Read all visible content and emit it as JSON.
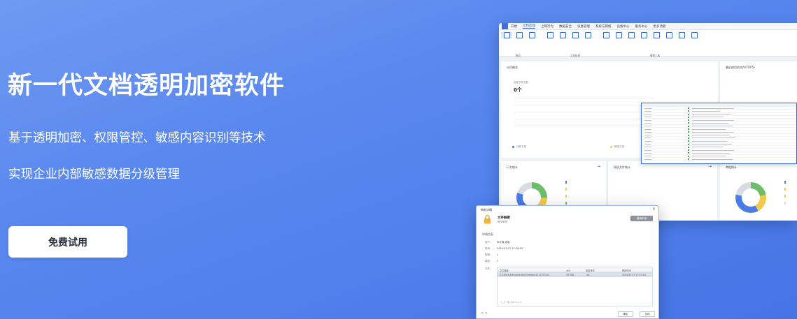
{
  "hero": {
    "title": "新一代文档透明加密软件",
    "line1": "基于透明加密、权限管控、敏感内容识别等技术",
    "line2": "实现企业内部敏感数据分级管理",
    "cta_label": "免费试用"
  },
  "app": {
    "menu": [
      "开始",
      "文档处理",
      "上网行为",
      "数据安全",
      "设备管理",
      "系统与网络",
      "设备中心",
      "服务中心",
      "更多功能"
    ],
    "active_menu": "文档处理",
    "ribbon_groups": [
      "概览",
      "文档处理",
      "管理工具"
    ],
    "overview": {
      "title": "分页概览",
      "sub": "加密文件总数",
      "value": "0个",
      "legend_left": "加密文档",
      "legend_right": "解密文档"
    },
    "recent_title": "最近使用的文件(TOP5)",
    "stats": [
      {
        "title": "行为统计"
      },
      {
        "title": "授权文件统计"
      },
      {
        "title": "审批统计"
      }
    ],
    "colors": {
      "accent": "#3d6fe0",
      "donut_blue": "#4a7be6",
      "donut_green": "#6dbd6a",
      "donut_yellow": "#f2c94c",
      "donut_gray": "#d7dbe2"
    }
  },
  "dialog": {
    "title": "审批详情",
    "file_name": "文件解密",
    "status": "等待审批",
    "action_button": "撤销申请",
    "section": "申请信息",
    "fields": [
      {
        "key": "用户:",
        "value": "本计算 老板"
      },
      {
        "key": "时间:",
        "value": "2024-03-27 17:06:02"
      },
      {
        "key": "权限:",
        "value": "1"
      },
      {
        "key": "原因:",
        "value": "1"
      },
      {
        "key": "文件:",
        "value": ""
      }
    ],
    "table": {
      "headers": [
        "文件路径",
        "大小",
        "加密状态",
        "修改时间"
      ],
      "row": [
        "C:\\Users\\Administrator\\Desktop\\1121323.xls",
        "26.7KB",
        ".xls",
        "2024-03-27 17:03:04"
      ]
    },
    "pagination": "< 上一页 1 of 1 > >",
    "footer_nav": "<  >",
    "btn_ok": "确定",
    "btn_close": "关闭"
  }
}
